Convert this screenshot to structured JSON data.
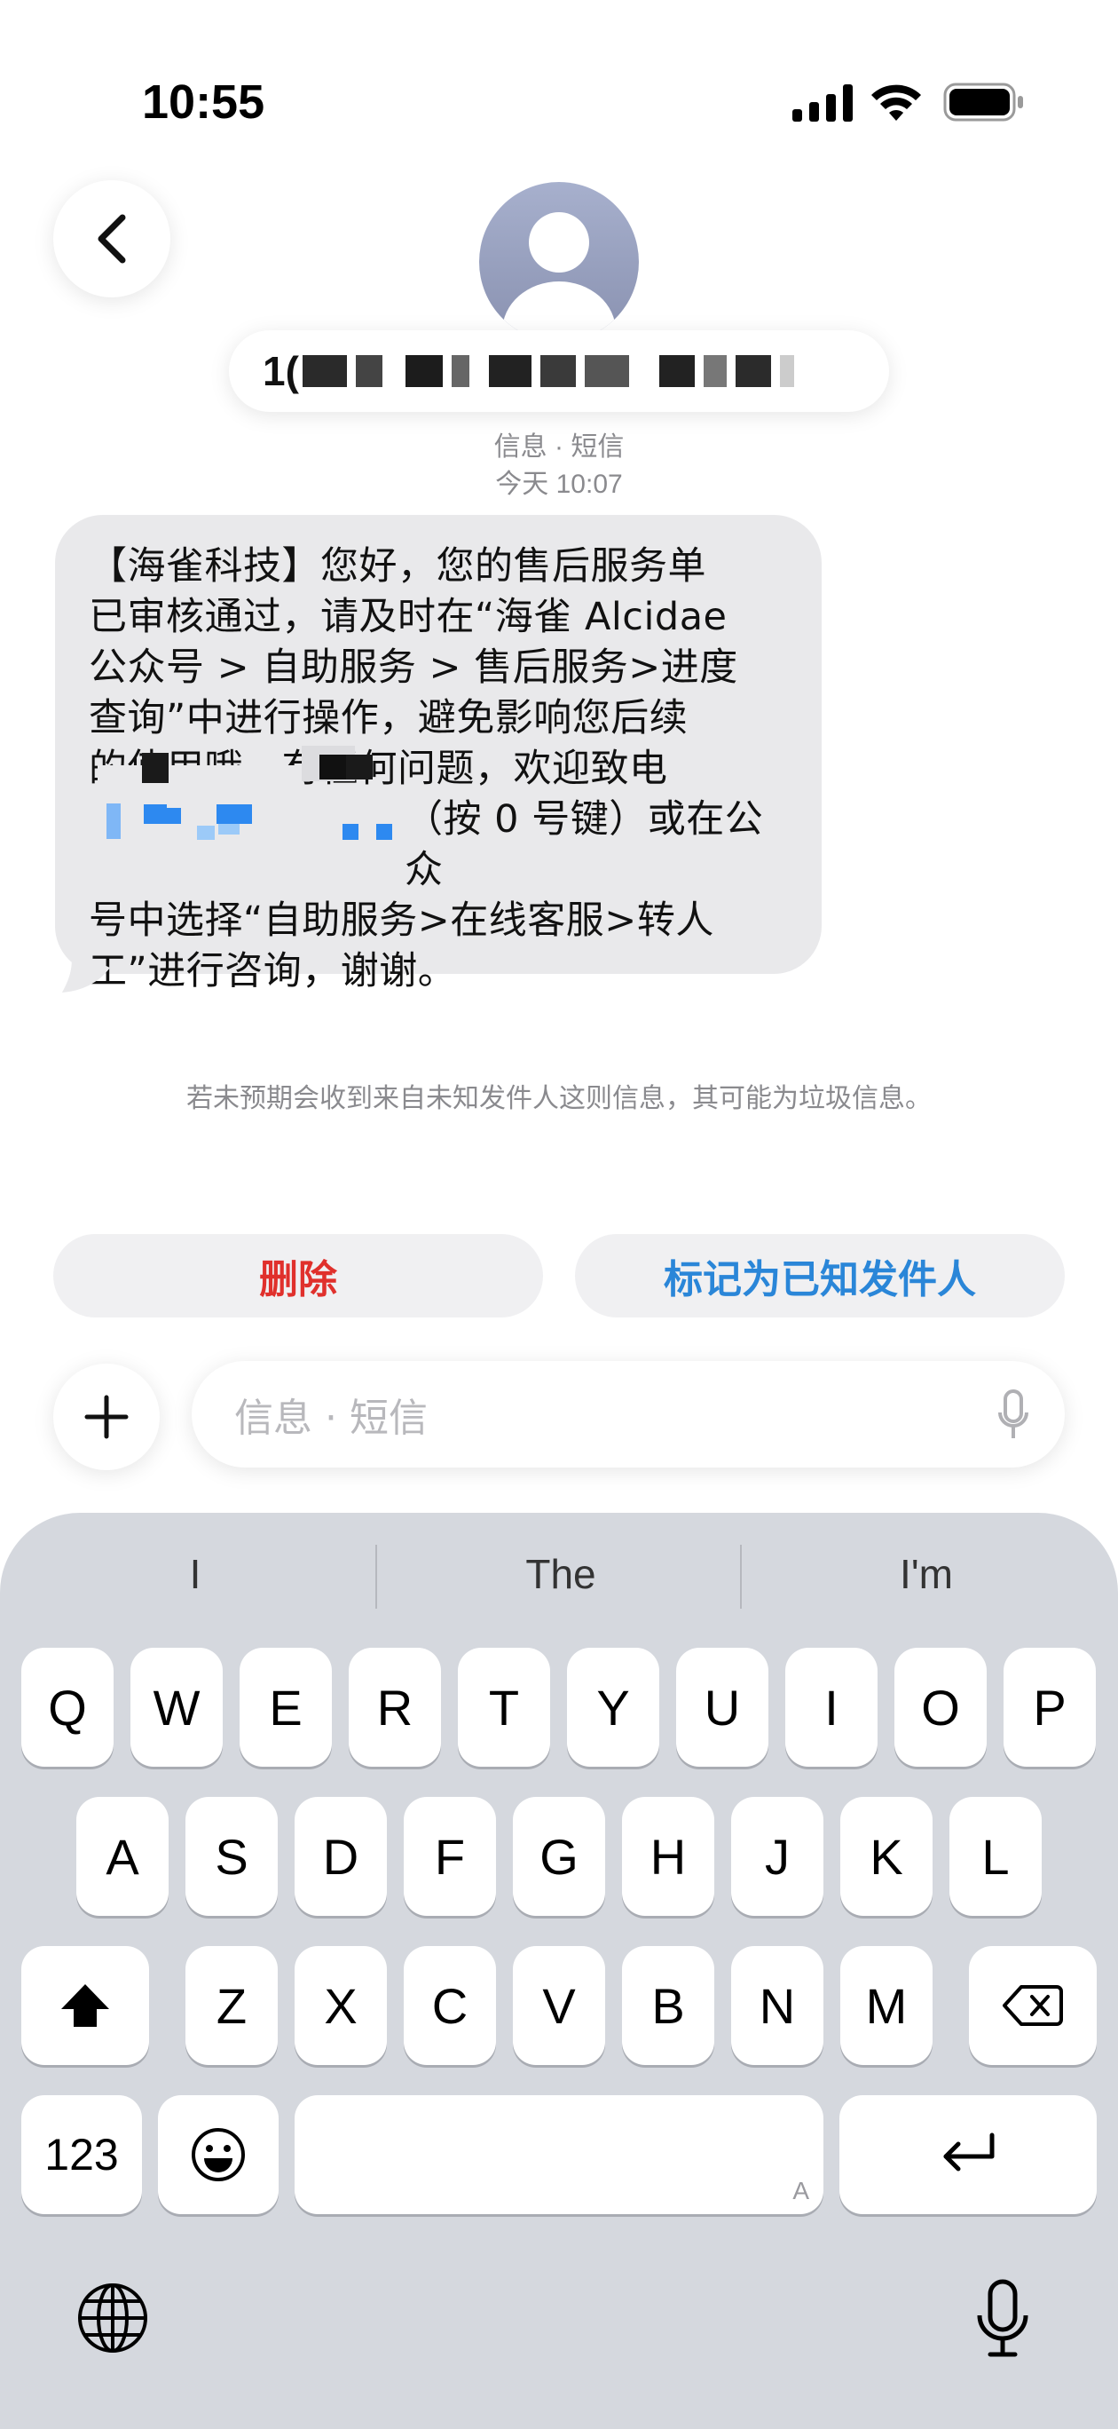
{
  "status_bar": {
    "time": "10:55"
  },
  "header": {
    "contact_prefix": "1(",
    "subtitle": "信息 · 短信",
    "timestamp": "今天 10:07"
  },
  "message": {
    "lines": [
      "【海雀科技】您好，您的售后服务单",
      "已审核通过，请及时在“海雀 Alcidae",
      "公众号 > 自助服务 > 售后服务>进度",
      "查询”中进行操作，避免影响您后续",
      "的使用哦。有任何问题，欢迎致电",
      "（按 0 号键）或在公众",
      "号中选择“自助服务>在线客服>转人",
      "工”进行咨询，谢谢。"
    ]
  },
  "warning_text": "若未预期会收到来自未知发件人这则信息，其可能为垃圾信息。",
  "actions": {
    "delete_label": "删除",
    "mark_known_label": "标记为已知发件人"
  },
  "input": {
    "placeholder": "信息 · 短信"
  },
  "keyboard": {
    "suggestions": [
      "I",
      "The",
      "I'm"
    ],
    "row1": [
      "Q",
      "W",
      "E",
      "R",
      "T",
      "Y",
      "U",
      "I",
      "O",
      "P"
    ],
    "row2": [
      "A",
      "S",
      "D",
      "F",
      "G",
      "H",
      "J",
      "K",
      "L"
    ],
    "row3": [
      "Z",
      "X",
      "C",
      "V",
      "B",
      "N",
      "M"
    ],
    "numbers_label": "123",
    "space_hint": "A"
  },
  "icons": {
    "back": "chevron-left-icon",
    "avatar": "person-icon",
    "plus": "plus-icon",
    "mic": "microphone-icon",
    "shift": "shift-icon",
    "delete": "backspace-icon",
    "emoji": "emoji-icon",
    "return": "return-icon",
    "globe": "globe-icon"
  },
  "colors": {
    "delete": "#e0302c",
    "mark_known": "#2a86d8",
    "keyboard_bg": "#d5d8de"
  }
}
